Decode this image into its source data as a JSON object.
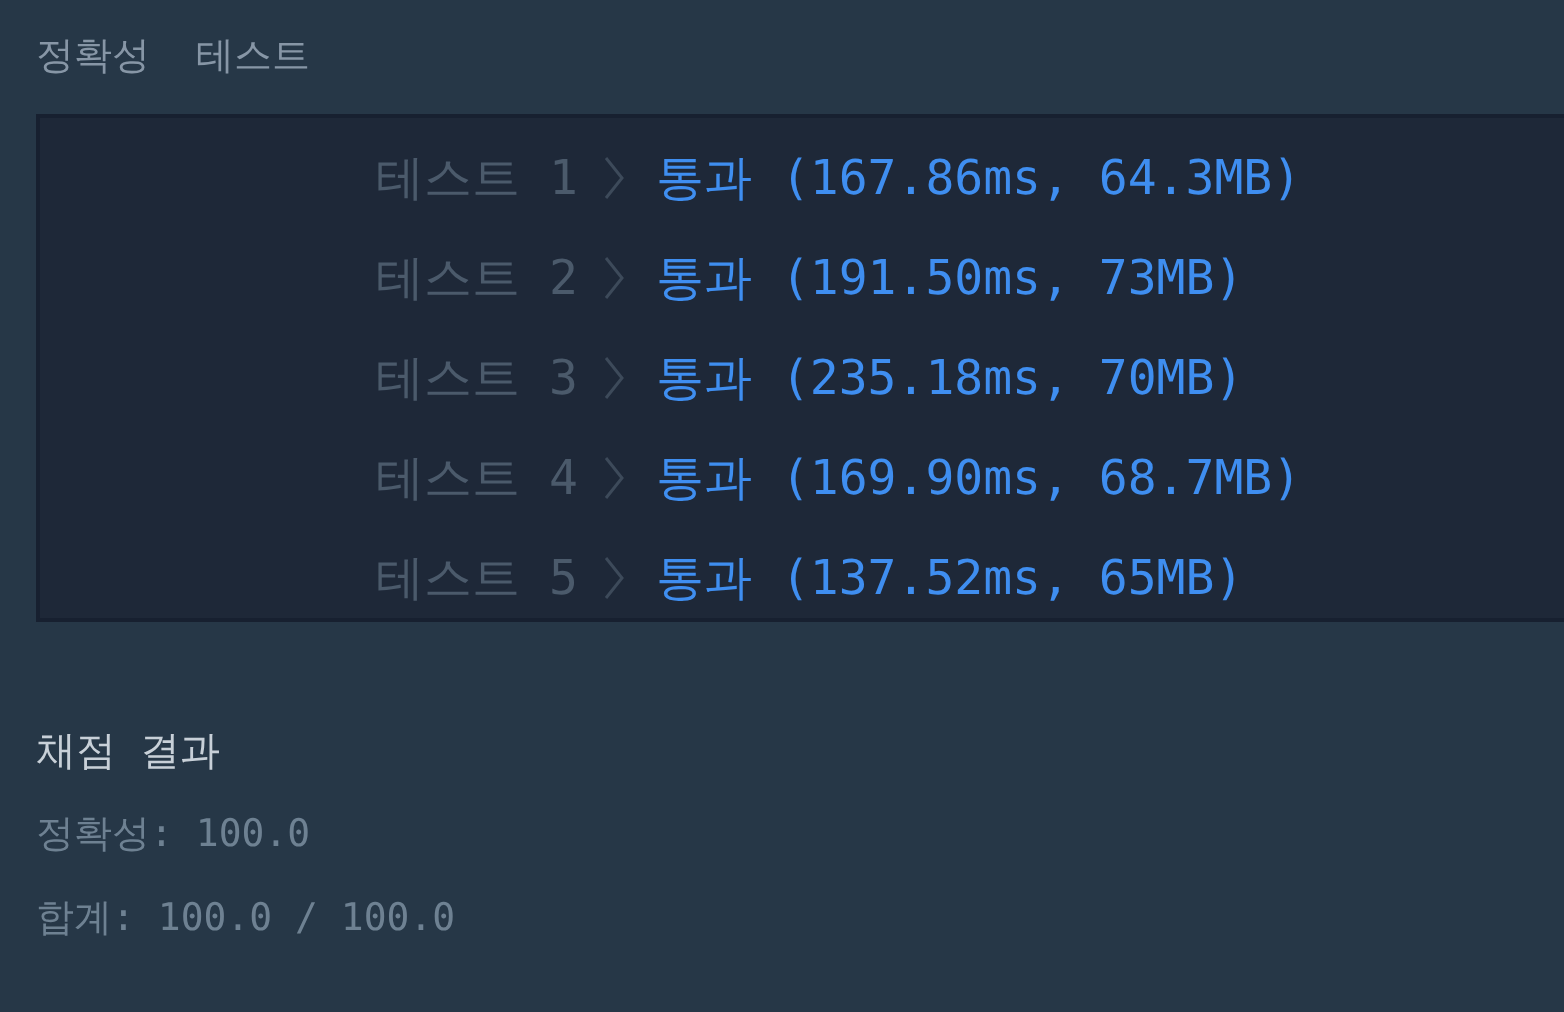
{
  "section_title": "정확성  테스트",
  "tests": [
    {
      "label": "테스트 1",
      "result": "통과 (167.86ms, 64.3MB)"
    },
    {
      "label": "테스트 2",
      "result": "통과 (191.50ms, 73MB)"
    },
    {
      "label": "테스트 3",
      "result": "통과 (235.18ms, 70MB)"
    },
    {
      "label": "테스트 4",
      "result": "통과 (169.90ms, 68.7MB)"
    },
    {
      "label": "테스트 5",
      "result": "통과 (137.52ms, 65MB)"
    }
  ],
  "summary": {
    "title": "채점 결과",
    "lines": [
      "정확성: 100.0",
      "합계: 100.0 / 100.0"
    ]
  }
}
